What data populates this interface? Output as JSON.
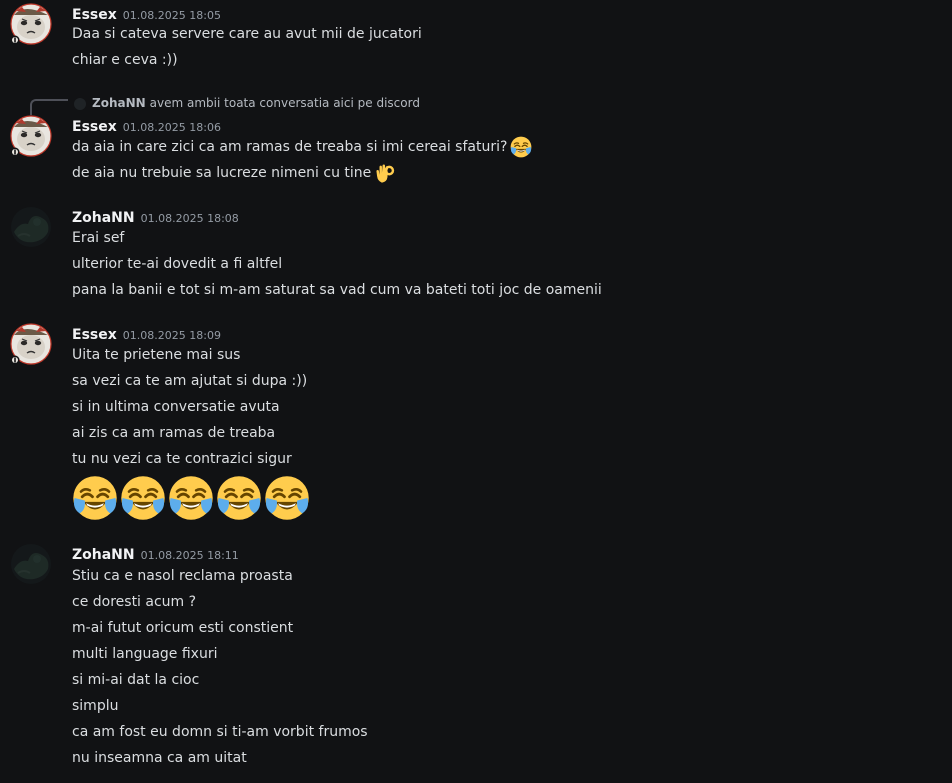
{
  "messages": [
    {
      "author": "Essex",
      "timestamp": "01.08.2025 18:05",
      "lines": [
        "Daa si cateva servere care au avut mii de jucatori",
        "chiar e ceva :))"
      ]
    },
    {
      "reply": {
        "author": "ZohaNN",
        "text": "avem ambii toata conversatia aici pe discord"
      },
      "author": "Essex",
      "timestamp": "01.08.2025 18:06",
      "lines": [
        "da aia in care zici ca am ramas de treaba si imi cereai sfaturi?",
        "de aia nu trebuie sa lucreze nimeni cu tine"
      ],
      "emojis": [
        "joy-emoji",
        "ok-hand-emoji"
      ]
    },
    {
      "author": "ZohaNN",
      "timestamp": "01.08.2025 18:08",
      "lines": [
        "Erai sef",
        "ulterior te-ai dovedit a fi altfel",
        "pana la banii e tot si m-am saturat sa vad cum va bateti toti joc de oamenii"
      ]
    },
    {
      "author": "Essex",
      "timestamp": "01.08.2025 18:09",
      "lines": [
        "Uita te prietene mai sus",
        "sa vezi ca te am ajutat si dupa :))",
        "si in ultima conversatie avuta",
        "ai zis ca am ramas de treaba",
        "tu nu vezi ca te contrazici sigur"
      ],
      "big_emoji_count": 5
    },
    {
      "author": "ZohaNN",
      "timestamp": "01.08.2025 18:11",
      "lines": [
        "Stiu ca e nasol reclama proasta",
        "ce doresti acum ?",
        "m-ai futut oricum esti constient",
        "multi language fixuri",
        "si mi-ai dat la cioc",
        "simplu",
        "ca am fost eu domn si ti-am vorbit frumos",
        "nu inseamna ca am uitat"
      ]
    }
  ],
  "colors": {
    "background": "#111214",
    "author": "#f2f3f5",
    "timestamp": "#949ba4",
    "text": "#dbdee1"
  }
}
